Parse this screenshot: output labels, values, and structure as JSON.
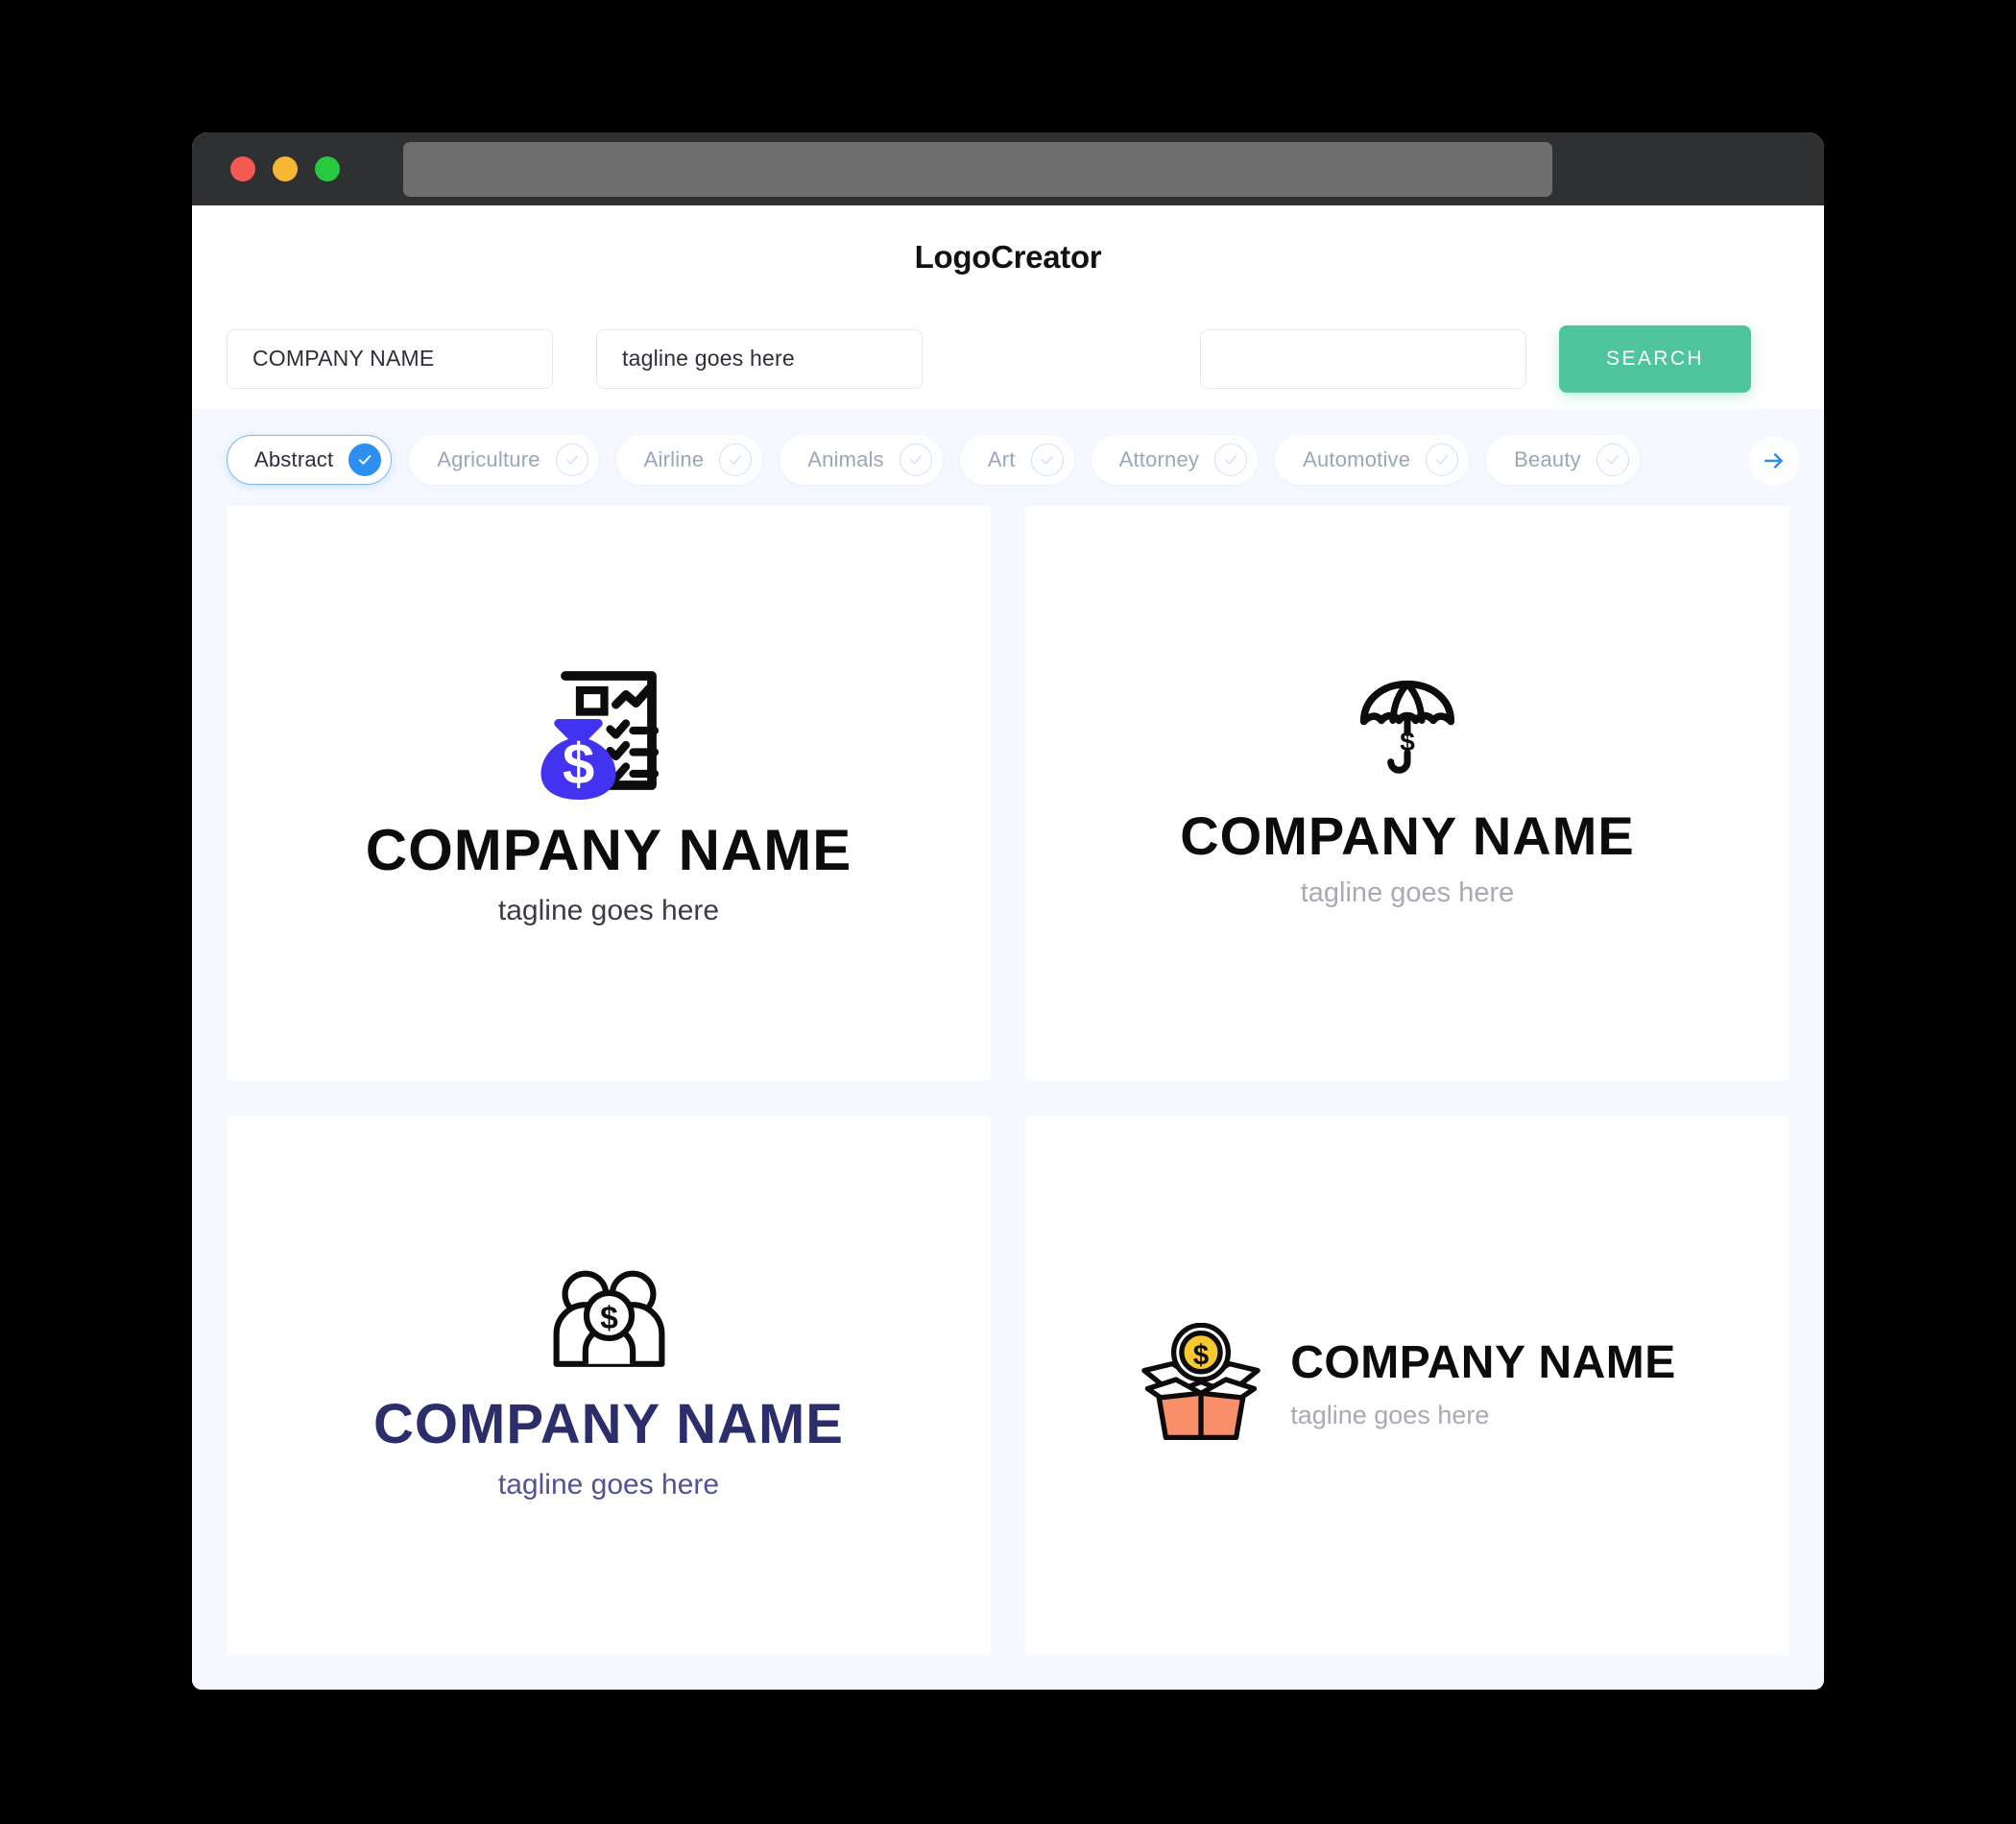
{
  "window": {
    "traffic_lights": [
      "close-red",
      "minimize-yellow",
      "maximize-green"
    ],
    "url_value": ""
  },
  "header": {
    "title": "LogoCreator"
  },
  "search": {
    "company_value": "COMPANY NAME",
    "tagline_value": "tagline goes here",
    "extra_value": "",
    "button_label": "SEARCH",
    "next_icon": "arrow-right-icon",
    "accent_green": "#4ec59c"
  },
  "categories": {
    "accent_blue": "#2d8ff0",
    "items": [
      {
        "label": "Abstract",
        "selected": true
      },
      {
        "label": "Agriculture",
        "selected": false
      },
      {
        "label": "Airline",
        "selected": false
      },
      {
        "label": "Animals",
        "selected": false
      },
      {
        "label": "Art",
        "selected": false
      },
      {
        "label": "Attorney",
        "selected": false
      },
      {
        "label": "Automotive",
        "selected": false
      },
      {
        "label": "Beauty",
        "selected": false
      }
    ]
  },
  "results": [
    {
      "icon": "money-bag-checklist-icon",
      "name": "COMPANY NAME",
      "tagline": "tagline goes here",
      "name_color": "#0c0c0c",
      "tagline_color": "#3a3d45",
      "accent_color": "#4133f0",
      "layout": "stacked"
    },
    {
      "icon": "umbrella-dollar-icon",
      "name": "COMPANY NAME",
      "tagline": "tagline goes here",
      "name_color": "#0c0c0c",
      "tagline_color": "#a8abb3",
      "accent_color": "#0c0c0c",
      "layout": "stacked"
    },
    {
      "icon": "people-dollar-icon",
      "name": "COMPANY NAME",
      "tagline": "tagline goes here",
      "name_color": "#2b2e6b",
      "tagline_color": "#50539a",
      "accent_color": "#0c0c0c",
      "layout": "stacked"
    },
    {
      "icon": "open-box-coin-icon",
      "name": "COMPANY NAME",
      "tagline": "tagline goes here",
      "name_color": "#0c0c0c",
      "tagline_color": "#a8abb3",
      "accent_color": "#f98e6a",
      "layout": "horizontal"
    }
  ]
}
